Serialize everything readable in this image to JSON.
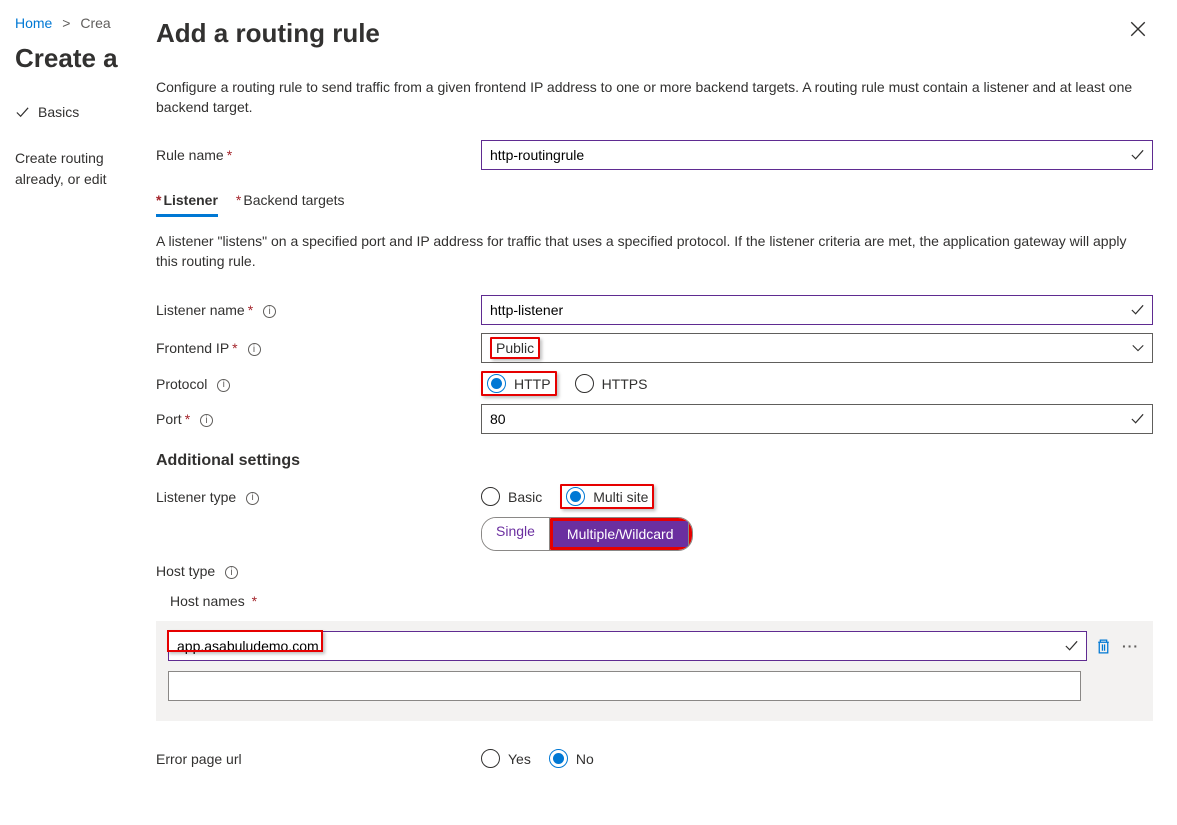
{
  "breadcrumb": {
    "home": "Home",
    "next": "Crea"
  },
  "leftTitle": "Create a",
  "step": "Basics",
  "leftDesc": "Create routing already, or edit",
  "panelTitle": "Add a routing rule",
  "desc": "Configure a routing rule to send traffic from a given frontend IP address to one or more backend targets. A routing rule must contain a listener and at least one backend target.",
  "rule": {
    "label": "Rule name",
    "value": "http-routingrule"
  },
  "tabs": {
    "listener": "Listener",
    "backend": "Backend targets"
  },
  "subDesc": "A listener \"listens\" on a specified port and IP address for traffic that uses a specified protocol. If the listener criteria are met, the application gateway will apply this routing rule.",
  "listener": {
    "nameLabel": "Listener name",
    "nameValue": "http-listener",
    "frontendLabel": "Frontend IP",
    "frontendValue": "Public",
    "protocolLabel": "Protocol",
    "protoHttp": "HTTP",
    "protoHttps": "HTTPS",
    "portLabel": "Port",
    "portValue": "80"
  },
  "additional": "Additional settings",
  "ltype": {
    "label": "Listener type",
    "basic": "Basic",
    "multi": "Multi site"
  },
  "hostType": {
    "label": "Host type",
    "single": "Single",
    "multi": "Multiple/Wildcard"
  },
  "hostNames": {
    "label": "Host names",
    "v0": "app.asabuludemo.com"
  },
  "errorPage": {
    "label": "Error page url",
    "yes": "Yes",
    "no": "No"
  }
}
